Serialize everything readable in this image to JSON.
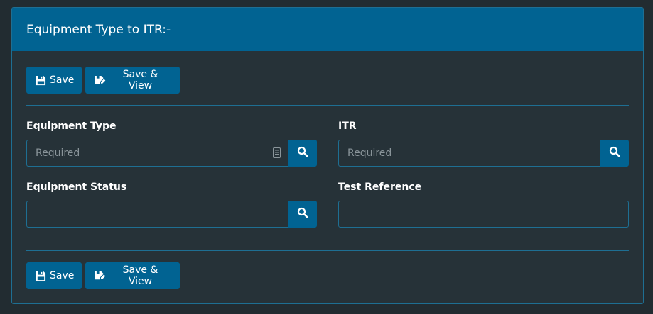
{
  "panel": {
    "title": "Equipment Type to ITR:-"
  },
  "toolbar": {
    "save_label": "Save",
    "save_view_label": "Save & View"
  },
  "fields": {
    "equipment_type": {
      "label": "Equipment Type",
      "value": "",
      "placeholder": "Required"
    },
    "itr": {
      "label": "ITR",
      "value": "",
      "placeholder": "Required"
    },
    "equipment_status": {
      "label": "Equipment Status",
      "value": "",
      "placeholder": ""
    },
    "test_reference": {
      "label": "Test Reference",
      "value": "",
      "placeholder": ""
    }
  },
  "icons": {
    "save": "floppy-disk-icon",
    "save_view": "edit-arrow-icon",
    "search": "search-icon",
    "keyboard": "keyboard-icon"
  },
  "colors": {
    "background": "#222c31",
    "panel_body": "#263238",
    "accent": "#016392",
    "border": "#1e6f93",
    "placeholder": "#8a959a"
  }
}
